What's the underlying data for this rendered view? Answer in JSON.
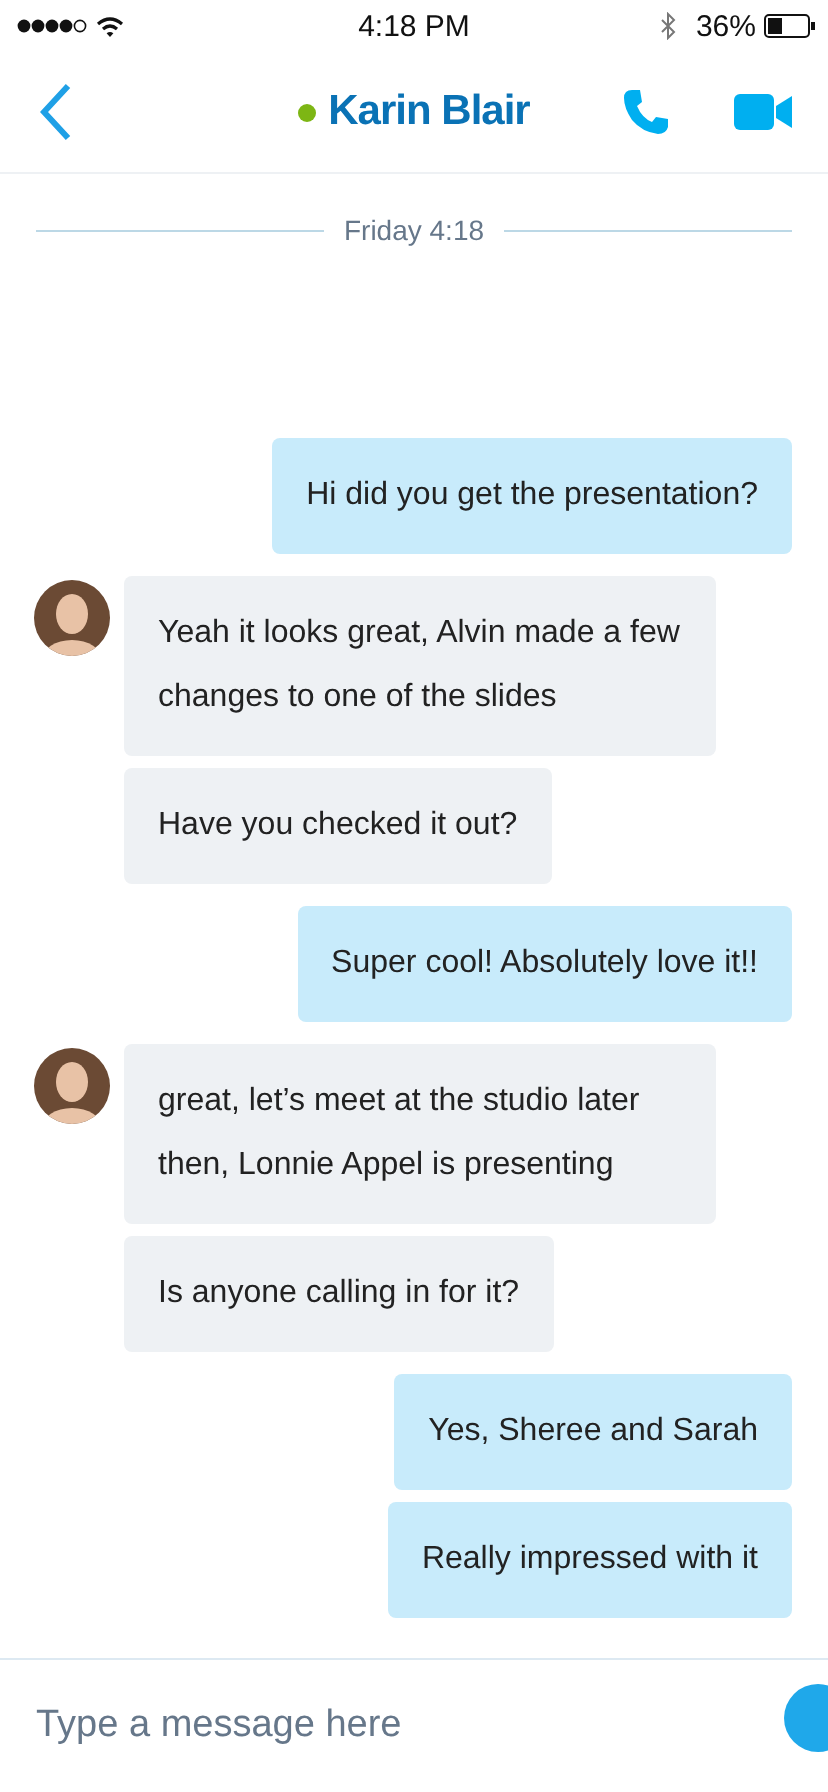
{
  "status_bar": {
    "time": "4:18 PM",
    "battery": "36%"
  },
  "header": {
    "contact": "Karin Blair",
    "online": true
  },
  "date_divider": "Friday 4:18",
  "messages": [
    {
      "kind": "sent",
      "text": "Hi did you get the presentation?"
    },
    {
      "kind": "received",
      "avatar": true,
      "text": "Yeah it looks great, Alvin made a few changes to one of the slides"
    },
    {
      "kind": "received",
      "avatar": false,
      "text": "Have you checked it out?"
    },
    {
      "kind": "sent",
      "text": "Super cool! Absolutely love it!!"
    },
    {
      "kind": "received",
      "avatar": true,
      "text": "great, let’s meet at the studio later then, Lonnie Appel is presenting"
    },
    {
      "kind": "received",
      "avatar": false,
      "text": "Is anyone calling in for it?"
    },
    {
      "kind": "sent",
      "text": "Yes, Sheree and Sarah"
    },
    {
      "kind": "sent",
      "text": "Really impressed with it"
    }
  ],
  "composer": {
    "placeholder": "Type a message here"
  }
}
